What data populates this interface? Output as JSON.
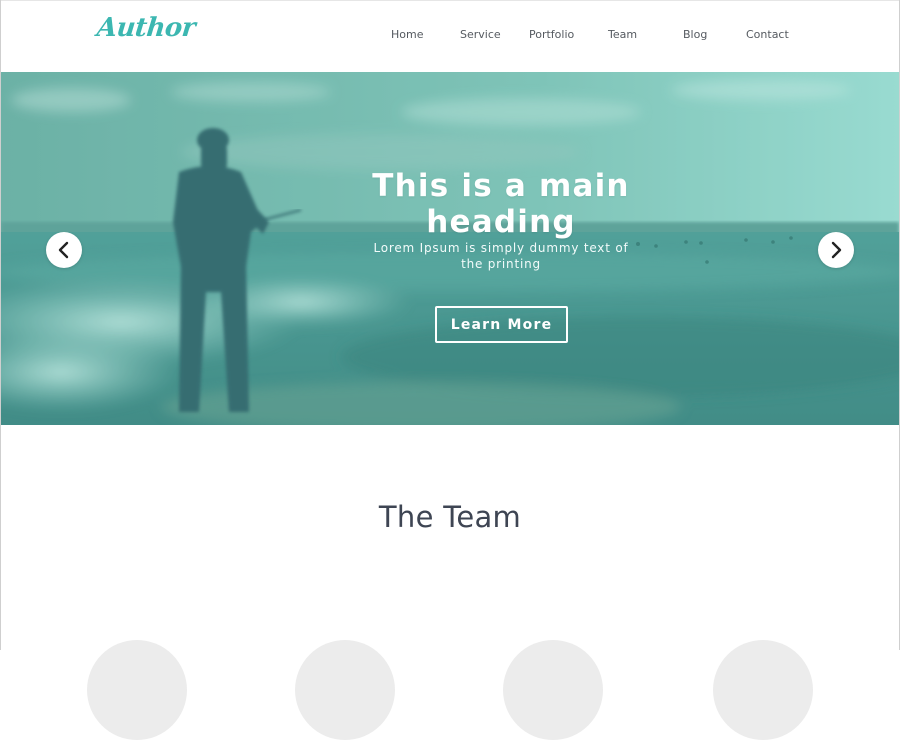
{
  "brand": {
    "logo_text": "Author",
    "accent": "#3cb7b1"
  },
  "nav": {
    "items": [
      {
        "label": "Home"
      },
      {
        "label": "Service"
      },
      {
        "label": "Portfolio"
      },
      {
        "label": "Team"
      },
      {
        "label": "Blog"
      },
      {
        "label": "Contact"
      }
    ]
  },
  "hero": {
    "heading": "This is a main heading",
    "subtext": "Lorem Ipsum is simply dummy text of the printing",
    "cta_label": "Learn More",
    "overlay_color": "#5fb8a8",
    "prev_icon": "chevron-left-icon",
    "next_icon": "chevron-right-icon"
  },
  "team": {
    "title": "The Team"
  }
}
